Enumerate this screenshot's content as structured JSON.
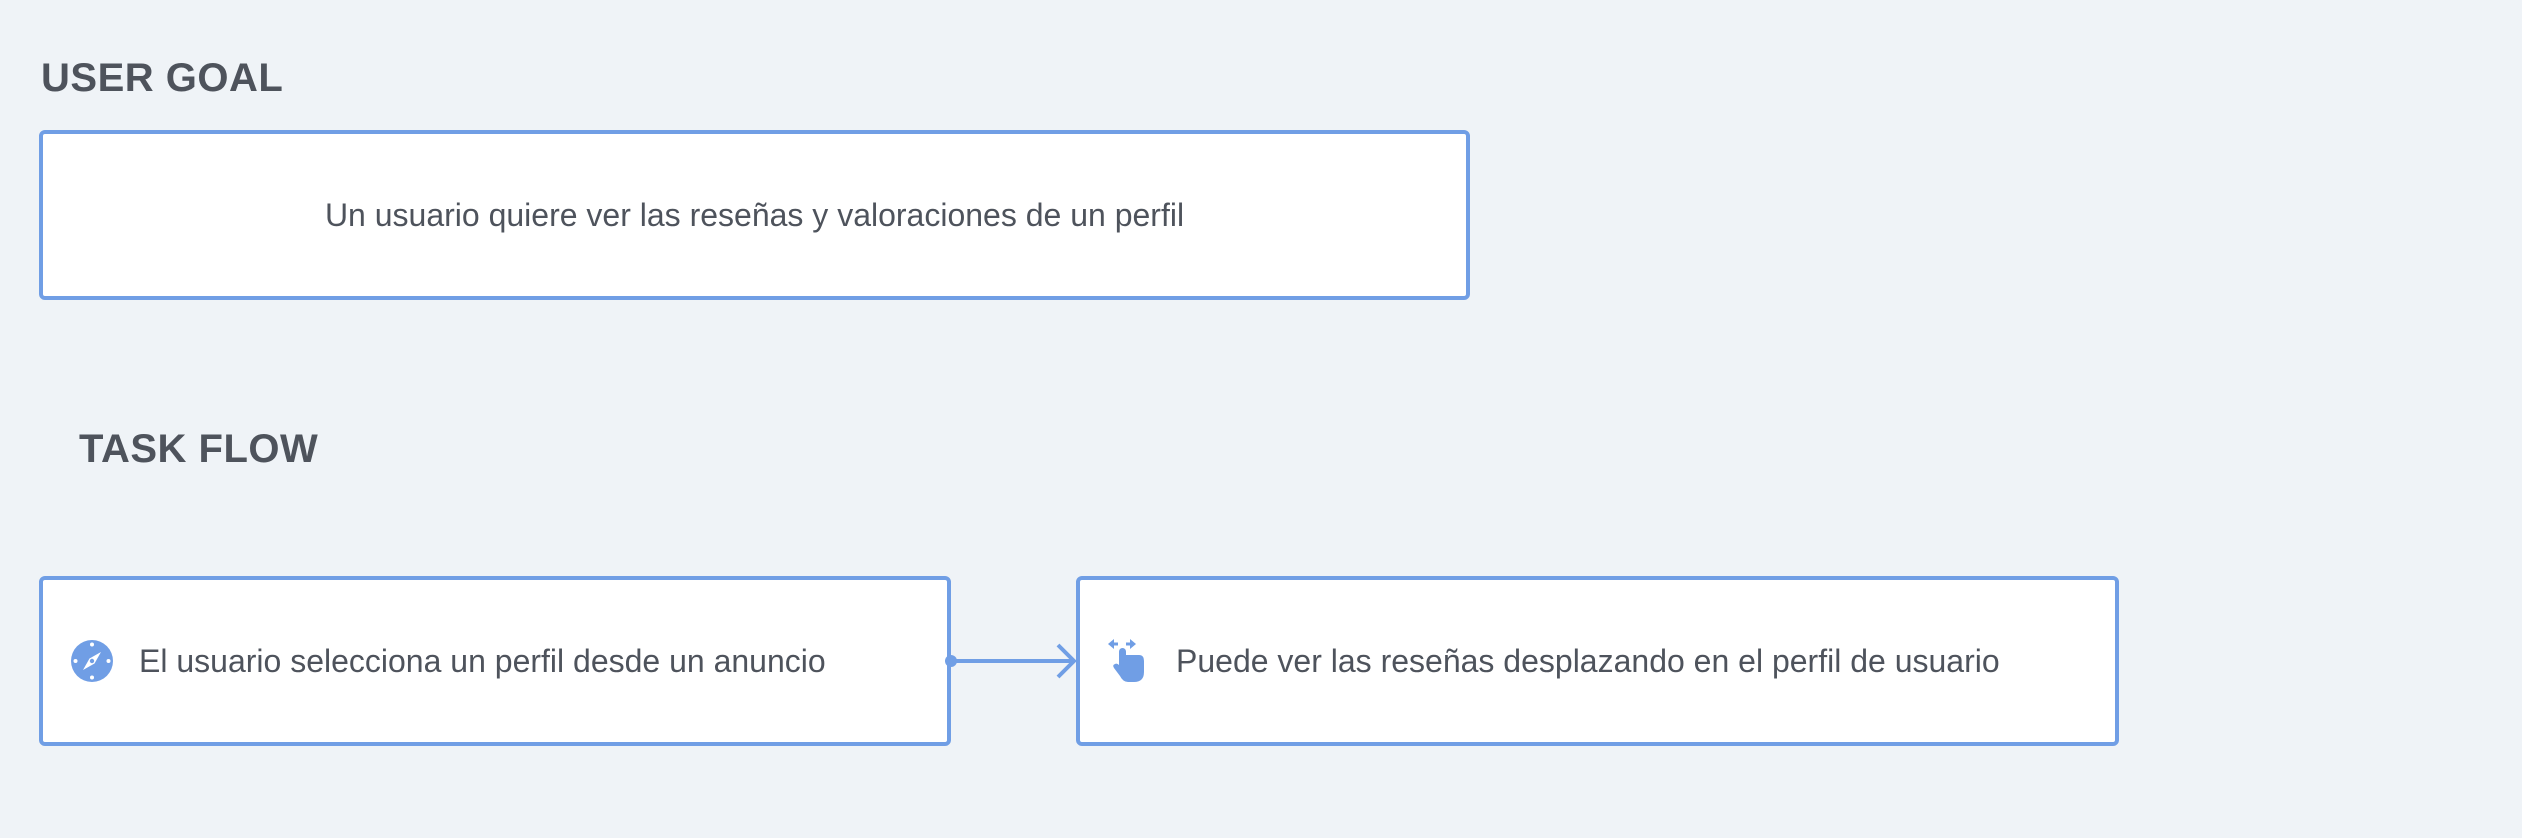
{
  "user_goal": {
    "title": "USER GOAL",
    "text": "Un usuario quiere ver las reseñas y valoraciones de un perfil"
  },
  "task_flow": {
    "title": "TASK FLOW",
    "steps": [
      {
        "icon": "compass-icon",
        "label": "El usuario selecciona un perfil desde un anuncio"
      },
      {
        "icon": "swipe-hand-icon",
        "label": "Puede ver las reseñas desplazando en el perfil de usuario"
      }
    ]
  },
  "colors": {
    "background": "#eff3f7",
    "accent": "#709ee5",
    "text": "#4e535c"
  }
}
